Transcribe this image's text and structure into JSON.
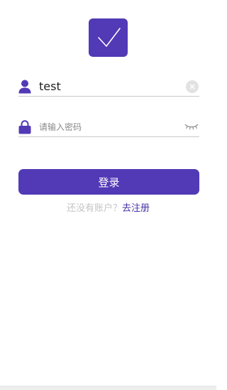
{
  "logo": {
    "icon": "checkmark-icon",
    "color": "#5239b6"
  },
  "username": {
    "icon": "user-icon",
    "value": "test",
    "clear_icon": "clear-circle-icon"
  },
  "password": {
    "icon": "lock-icon",
    "placeholder": "请输入密码",
    "toggle_icon": "eye-closed-icon"
  },
  "login": {
    "label": "登录"
  },
  "register": {
    "hint": "还没有账户？",
    "link": "去注册"
  },
  "colors": {
    "accent": "#5239b6",
    "link": "#4a32a8",
    "hint": "#c4c4c4"
  }
}
